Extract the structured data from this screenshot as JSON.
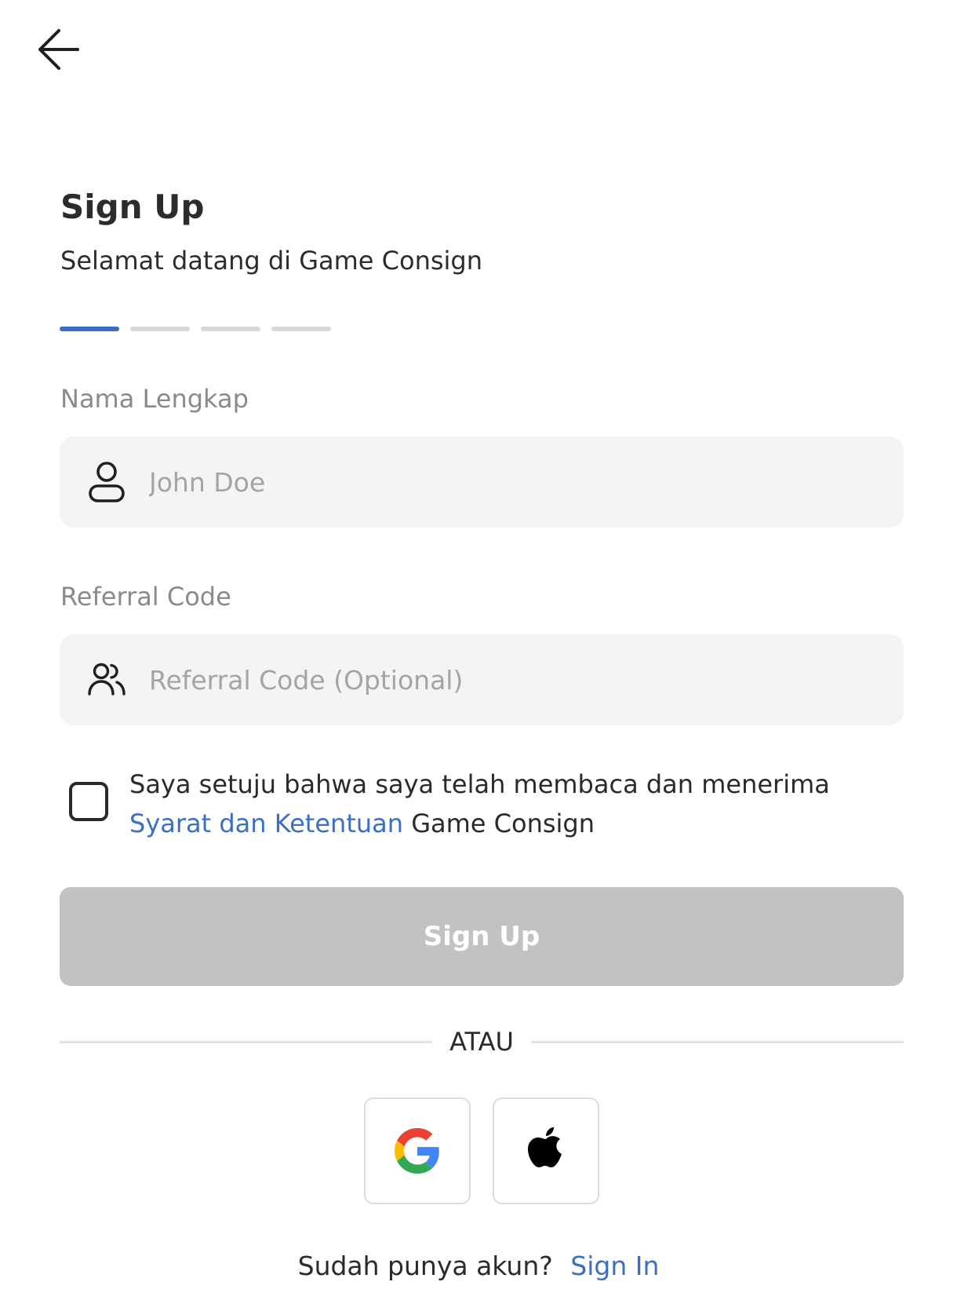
{
  "icons": {
    "back": "arrow-left-icon",
    "name_field": "user-icon",
    "referral_field": "users-icon",
    "google": "google-icon",
    "apple": "apple-icon"
  },
  "header": {
    "title": "Sign Up",
    "subtitle": "Selamat datang di Game Consign"
  },
  "stepper": {
    "total_steps": 4,
    "current_step": 1
  },
  "form": {
    "name": {
      "label": "Nama Lengkap",
      "placeholder": "John Doe",
      "value": ""
    },
    "referral": {
      "label": "Referral Code",
      "placeholder": "Referral Code (Optional)",
      "value": ""
    },
    "terms": {
      "checked": false,
      "text_before": "Saya setuju bahwa saya telah membaca dan menerima",
      "link_text": "Syarat dan Ketentuan",
      "text_after": " Game Consign"
    },
    "submit_label": "Sign Up"
  },
  "divider_text": "ATAU",
  "footer": {
    "prompt": "Sudah punya akun?",
    "signin_label": "Sign In"
  },
  "colors": {
    "accent": "#3a6fc4",
    "button_disabled": "#c2c2c2",
    "input_bg": "#f4f4f4",
    "label": "#8a8a8a"
  }
}
